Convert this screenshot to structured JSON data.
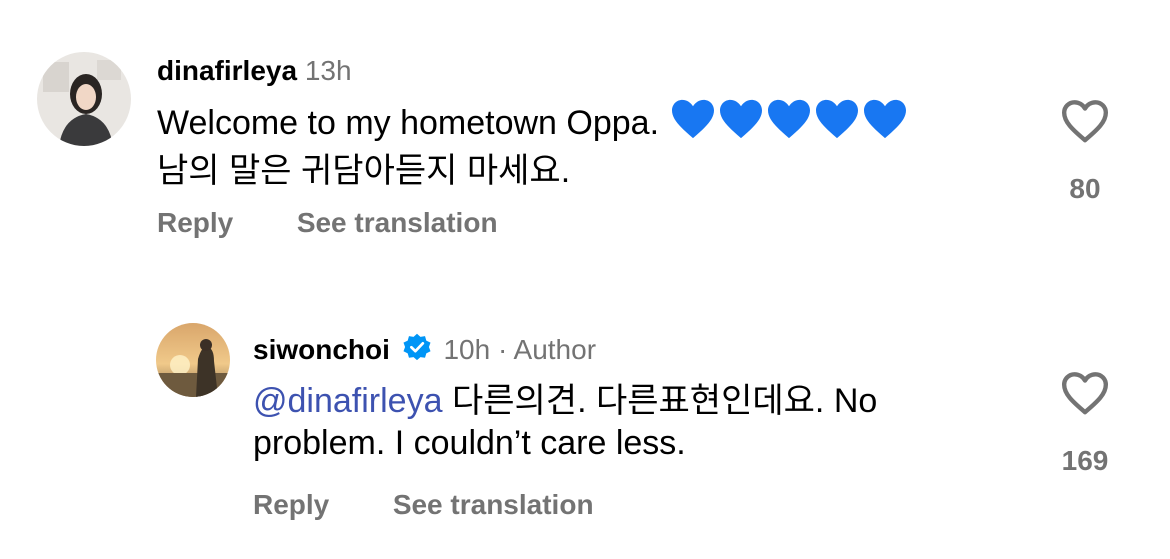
{
  "comments": [
    {
      "username": "dinafirleya",
      "time": "13h",
      "text": "Welcome to my hometown Oppa.",
      "text_line2": "남의 말은 귀담아듣지 마세요.",
      "emoji": "💙💙💙💙💙",
      "reply_label": "Reply",
      "translate_label": "See translation",
      "like_count": "80"
    },
    {
      "username": "siwonchoi",
      "time": "10h",
      "separator": "·",
      "author_label": "Author",
      "mention": "@dinafirleya",
      "text": "다른의견. 다른표현인데요. No",
      "text_line2": "problem. I couldn’t care less.",
      "reply_label": "Reply",
      "translate_label": "See translation",
      "like_count": "169"
    }
  ],
  "colors": {
    "secondary_text": "#737373",
    "mention": "#3d52b0",
    "verified_badge": "#0095f6",
    "heart_emoji": "#1877f2"
  }
}
